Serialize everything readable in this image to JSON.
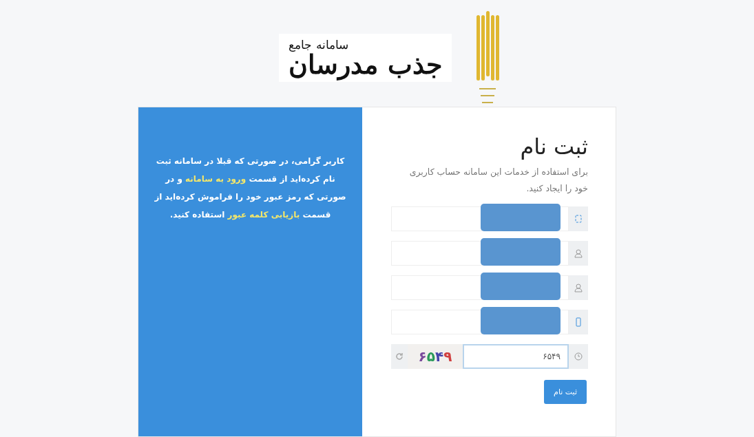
{
  "logo": {
    "subtitle": "سامانه جامع",
    "title": "جذب مدرسان"
  },
  "info_panel": {
    "segments": [
      {
        "text": "کاربر گرامی، در صورتی که قبلا در سامانه ثبت نام کرده‌اید از قسمت ",
        "link": false
      },
      {
        "text": "ورود به سامانه",
        "link": true
      },
      {
        "text": " و در صورتی که رمز عبور خود را فراموش کرده‌اید از قسمت ",
        "link": false
      },
      {
        "text": "بازیابی کلمه عبور",
        "link": true
      },
      {
        "text": " استفاده کنید.",
        "link": false
      }
    ]
  },
  "form": {
    "title": "ثبت نام",
    "description": "برای استفاده از خدمات این سامانه حساب کاربری خود را ایجاد کنید.",
    "fields": [
      {
        "kind": "id",
        "redacted": true
      },
      {
        "kind": "user",
        "redacted": true
      },
      {
        "kind": "user",
        "redacted": true
      },
      {
        "kind": "mobile",
        "redacted": true
      }
    ],
    "captcha": {
      "value": "۶۵۴۹",
      "image_text": "۶۵۴۹"
    },
    "submit": "ثبت نام"
  }
}
